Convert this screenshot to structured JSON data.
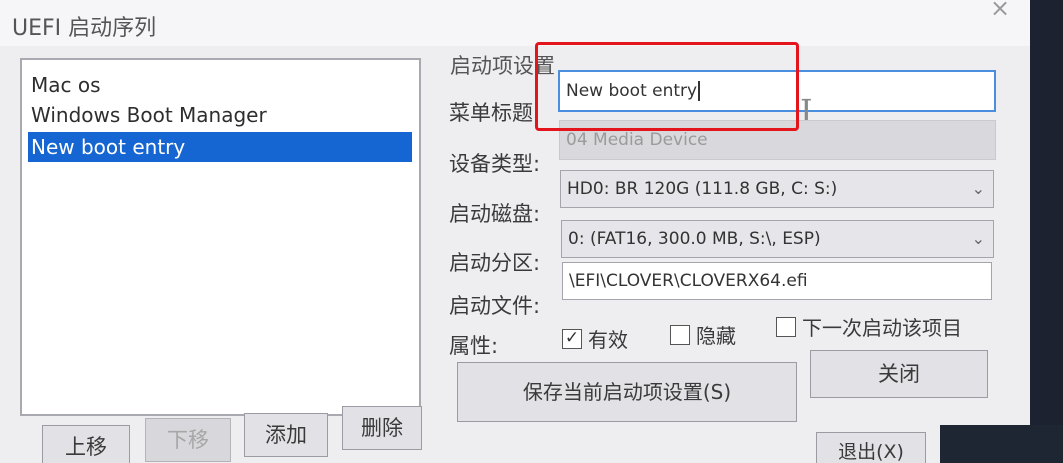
{
  "window": {
    "title": "UEFI 启动序列",
    "close_glyph": "×"
  },
  "boot_list": {
    "items": [
      "Mac os",
      "Windows Boot Manager",
      "New boot entry"
    ],
    "selected_index": 2
  },
  "list_buttons": {
    "move_up": "上移",
    "move_down": "下移",
    "add": "添加",
    "delete": "删除"
  },
  "settings": {
    "group_title": "启动项设置",
    "menu_title": {
      "label": "菜单标题:",
      "value": "New boot entry"
    },
    "device_type": {
      "label": "设备类型:",
      "value": "04  Media Device"
    },
    "boot_disk": {
      "label": "启动磁盘:",
      "value": "HD0: BR  120G (111.8 GB, C: S:)"
    },
    "boot_partition": {
      "label": "启动分区:",
      "value": "0: (FAT16, 300.0 MB, S:\\, ESP)"
    },
    "boot_file": {
      "label": "启动文件:",
      "value": "\\EFI\\CLOVER\\CLOVERX64.efi"
    },
    "attributes": {
      "label": "属性:",
      "active": {
        "label": "有效",
        "checked": true
      },
      "hidden": {
        "label": "隐藏",
        "checked": false
      },
      "next_boot": {
        "label": "下一次启动该项目",
        "checked": false
      }
    }
  },
  "actions": {
    "save": "保存当前启动项设置(S)",
    "close": "关闭",
    "exit": "退出(X)"
  },
  "colors": {
    "selection": "#1565d2",
    "annotation_box": "#e3141c",
    "focus_border": "#4a8ee0"
  },
  "icons": {
    "dropdown": "chevron-down-icon",
    "checkmark": "✓"
  }
}
